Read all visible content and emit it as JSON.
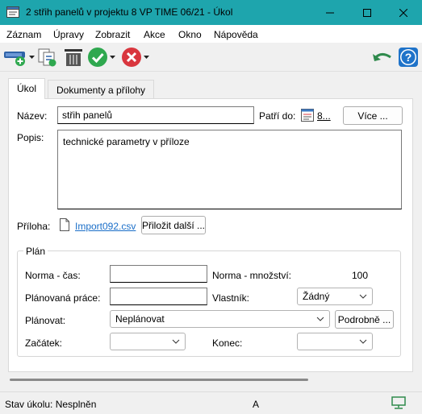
{
  "window": {
    "title": "2 střih panelů v projektu 8 VP  TIME  06/21  - Úkol",
    "controls": [
      "minimize-icon",
      "maximize-icon",
      "close-icon"
    ]
  },
  "menu": [
    "Záznam",
    "Úpravy",
    "Zobrazit",
    "Akce",
    "Okno",
    "Nápověda"
  ],
  "toolbar": {
    "icons": [
      "new-task-icon",
      "copy-icon",
      "delete-icon",
      "complete-icon",
      "cancel-icon",
      "undo-icon",
      "help-icon"
    ],
    "colors": {
      "green": "#2fa84f",
      "red": "#d9363e",
      "blue": "#1f73c9",
      "teal": "#1ea5ad"
    }
  },
  "tabs": [
    "Úkol",
    "Dokumenty a přílohy"
  ],
  "form": {
    "name_label": "Název:",
    "name_value": "střih panelů",
    "belongs_label": "Patří do:",
    "belongs_value": "8...",
    "more_button": "Více ...",
    "desc_label": "Popis:",
    "desc_value": "technické parametry v příloze",
    "attachment_label": "Příloha:",
    "attachment_file": "Import092.csv",
    "attach_more_button": "Přiložit další ..."
  },
  "plan": {
    "group_label": "Plán",
    "norm_time_label": "Norma - čas:",
    "norm_time_value": "",
    "norm_qty_label": "Norma - množství:",
    "norm_qty_value": "100",
    "planned_work_label": "Plánovaná práce:",
    "planned_work_value": "",
    "owner_label": "Vlastník:",
    "owner_value": "Žádný",
    "schedule_label": "Plánovat:",
    "schedule_value": "Neplánovat",
    "details_button": "Podrobně ...",
    "start_label": "Začátek:",
    "start_value": "",
    "end_label": "Konec:",
    "end_value": ""
  },
  "status": {
    "state": "Stav úkolu: Nesplněn",
    "mode": "A"
  }
}
